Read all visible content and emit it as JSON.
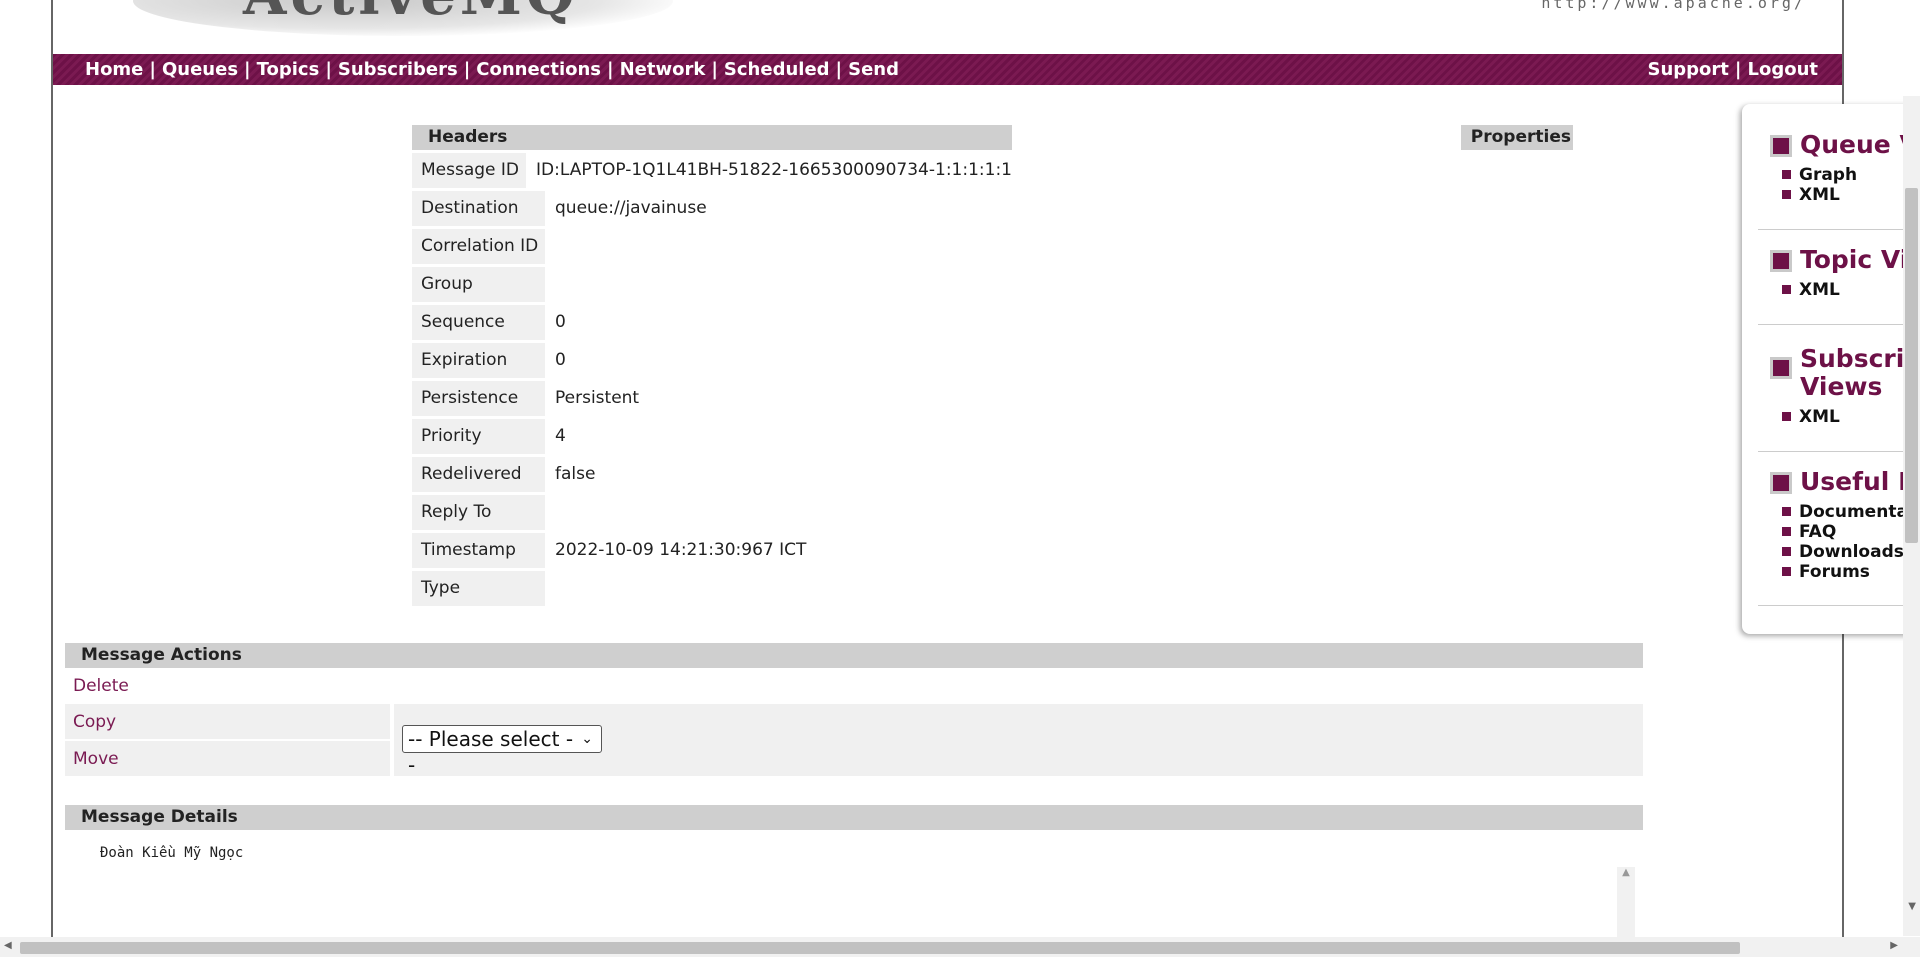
{
  "header": {
    "logo_text": "ActiveMQ",
    "apache_url": "http://www.apache.org/"
  },
  "nav": {
    "left": [
      "Home",
      "Queues",
      "Topics",
      "Subscribers",
      "Connections",
      "Network",
      "Scheduled",
      "Send"
    ],
    "right": [
      "Support",
      "Logout"
    ],
    "separator": "|"
  },
  "headers": {
    "title": "Headers",
    "rows": [
      {
        "label": "Message ID",
        "value": "ID:LAPTOP-1Q1L41BH-51822-1665300090734-1:1:1:1:1"
      },
      {
        "label": "Destination",
        "value": "queue://javainuse"
      },
      {
        "label": "Correlation ID",
        "value": ""
      },
      {
        "label": "Group",
        "value": ""
      },
      {
        "label": "Sequence",
        "value": "0"
      },
      {
        "label": "Expiration",
        "value": "0"
      },
      {
        "label": "Persistence",
        "value": "Persistent"
      },
      {
        "label": "Priority",
        "value": "4"
      },
      {
        "label": "Redelivered",
        "value": "false"
      },
      {
        "label": "Reply To",
        "value": ""
      },
      {
        "label": "Timestamp",
        "value": "2022-10-09 14:21:30:967 ICT"
      },
      {
        "label": "Type",
        "value": ""
      }
    ]
  },
  "properties": {
    "title": "Properties"
  },
  "actions": {
    "title": "Message Actions",
    "delete": "Delete",
    "copy": "Copy",
    "move": "Move",
    "select_value": "-- Please select --"
  },
  "details": {
    "title": "Message Details",
    "body": "Đoàn Kiều Mỹ Ngọc"
  },
  "right_panel": {
    "groups": [
      {
        "heading": "Queue Views",
        "links": [
          "Graph",
          "XML"
        ]
      },
      {
        "heading": "Topic Views",
        "links": [
          "XML"
        ]
      },
      {
        "heading": "Subscribers Views",
        "links": [
          "XML"
        ]
      },
      {
        "heading": "Useful Links",
        "links": [
          "Documentation",
          "FAQ",
          "Downloads",
          "Forums"
        ]
      }
    ]
  },
  "colors": {
    "accent": "#6d1147",
    "section_header_bg": "#cfcfcf",
    "label_bg": "#f0f0f0",
    "link": "#7a1a52"
  }
}
